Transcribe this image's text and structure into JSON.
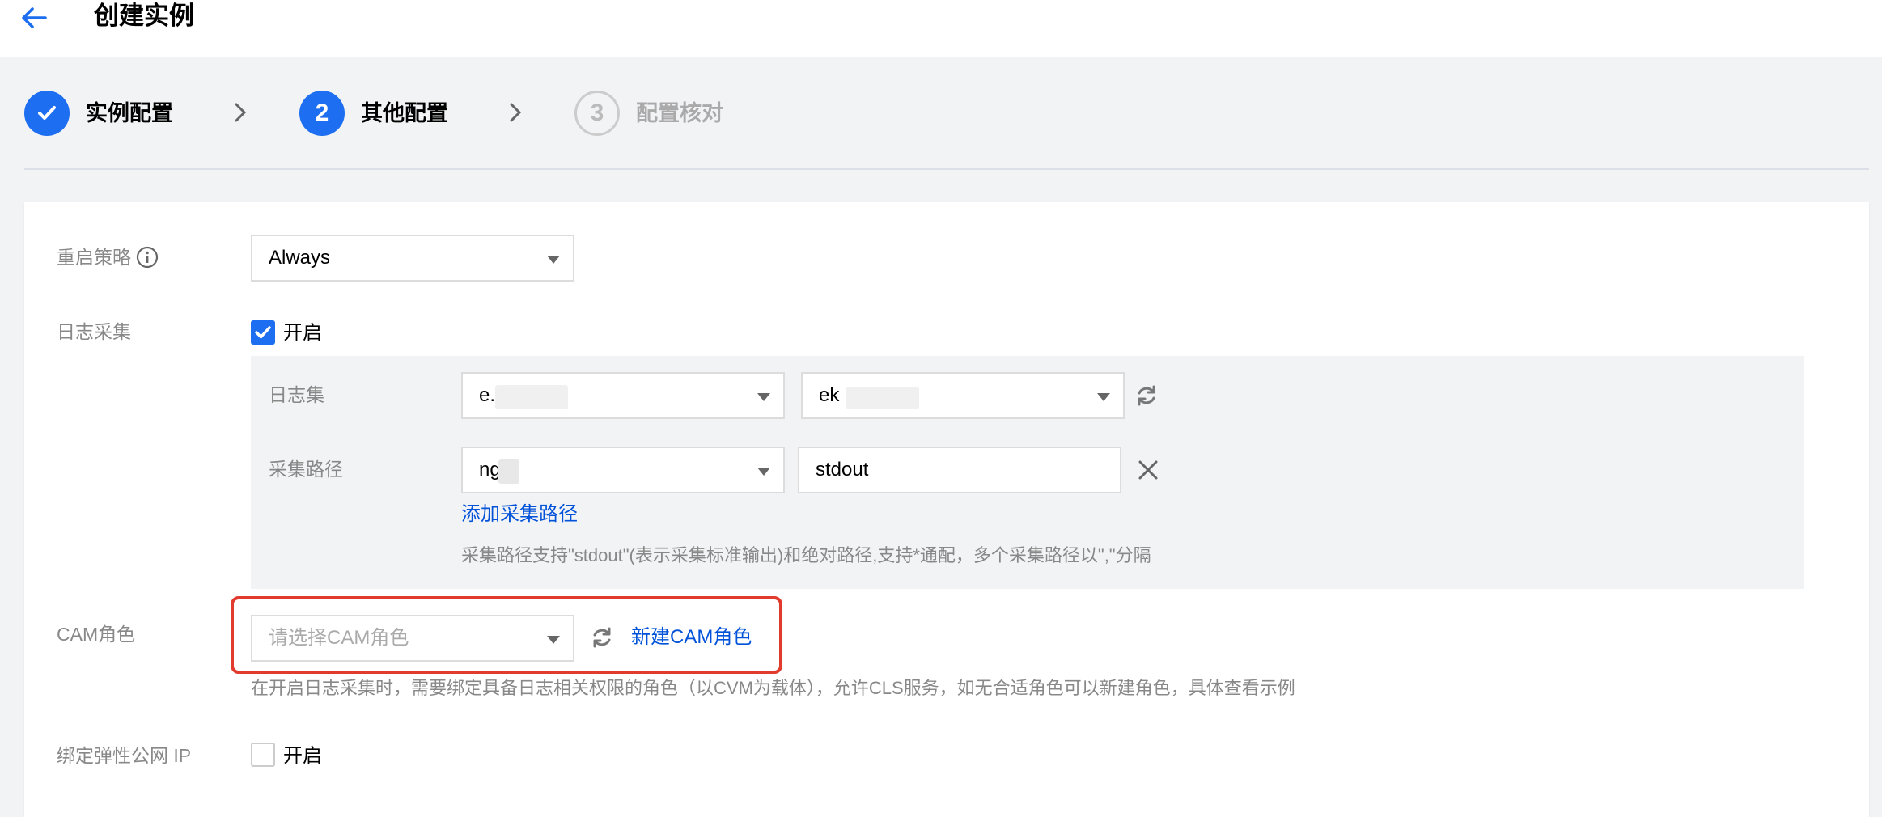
{
  "page": {
    "title": "创建实例",
    "back_icon": "arrow-left-icon"
  },
  "steps": [
    {
      "label": "实例配置",
      "state": "done",
      "icon": "check-icon"
    },
    {
      "label": "其他配置",
      "state": "active",
      "number": "2"
    },
    {
      "label": "配置核对",
      "state": "pending",
      "number": "3"
    }
  ],
  "form": {
    "restart_policy": {
      "label": "重启策略",
      "info_icon": "info-icon",
      "value": "Always"
    },
    "log_collection": {
      "label": "日志采集",
      "checkbox_label": "开启",
      "checked": true,
      "logset": {
        "label": "日志集",
        "value_1": "e.",
        "value_2": "ek",
        "refresh_icon": "refresh-icon"
      },
      "path": {
        "label": "采集路径",
        "select_value": "ng",
        "input_value": "stdout",
        "remove_icon": "close-icon"
      },
      "add_path_link": "添加采集路径",
      "hint": "采集路径支持\"stdout\"(表示采集标准输出)和绝对路径,支持*通配，多个采集路径以\",\"分隔"
    },
    "cam_role": {
      "label": "CAM角色",
      "placeholder": "请选择CAM角色",
      "refresh_icon": "refresh-icon",
      "new_role_link": "新建CAM角色",
      "hint": "在开启日志采集时，需要绑定具备日志相关权限的角色（以CVM为载体），允许CLS服务，如无合适角色可以新建角色，具体查看示例"
    },
    "eip": {
      "label": "绑定弹性公网 IP",
      "checkbox_label": "开启",
      "checked": false
    }
  },
  "colors": {
    "accent": "#1d6ef0",
    "link": "#0052d9",
    "highlight": "#e03b2d",
    "background": "#f2f3f5"
  }
}
